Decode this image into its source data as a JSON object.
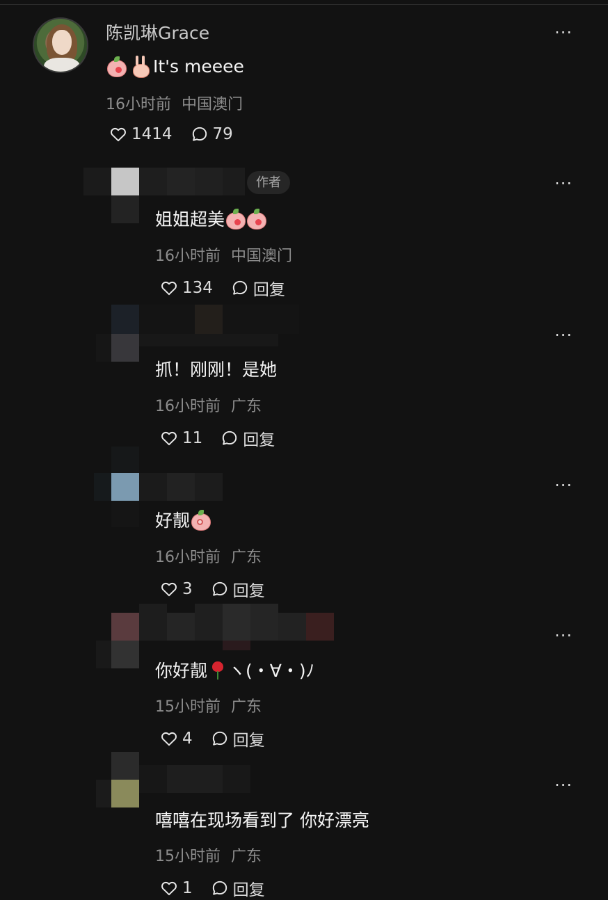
{
  "post": {
    "username": "陈凯琳Grace",
    "text": "It's meeee",
    "emojis": [
      "peach-blush-emoji",
      "bunny-peace-emoji"
    ],
    "time": "16小时前",
    "location": "中国澳门",
    "likes": "1414",
    "comments": "79",
    "more": "···"
  },
  "comments": [
    {
      "badge": "作者",
      "text": "姐姐超美",
      "emojis": [
        "peach-blush-emoji",
        "peach-blush-emoji"
      ],
      "time": "16小时前",
      "location": "中国澳门",
      "likes": "134",
      "reply_label": "回复",
      "more": "···"
    },
    {
      "text": "抓！刚刚！是她",
      "time": "16小时前",
      "location": "广东",
      "likes": "11",
      "reply_label": "回复",
      "more": "···"
    },
    {
      "text": "好靓",
      "emojis": [
        "peach-shock-emoji"
      ],
      "time": "16小时前",
      "location": "广东",
      "likes": "3",
      "reply_label": "回复",
      "more": "···"
    },
    {
      "text_before": "你好靓",
      "emojis": [
        "rose-emoji"
      ],
      "text_after": "ヽ(・∀・)ﾉ",
      "time": "15小时前",
      "location": "广东",
      "likes": "4",
      "reply_label": "回复",
      "more": "···"
    },
    {
      "text": "嘻嘻在现场看到了 你好漂亮",
      "time": "15小时前",
      "location": "广东",
      "likes": "1",
      "reply_label": "回复",
      "more": "···"
    }
  ]
}
